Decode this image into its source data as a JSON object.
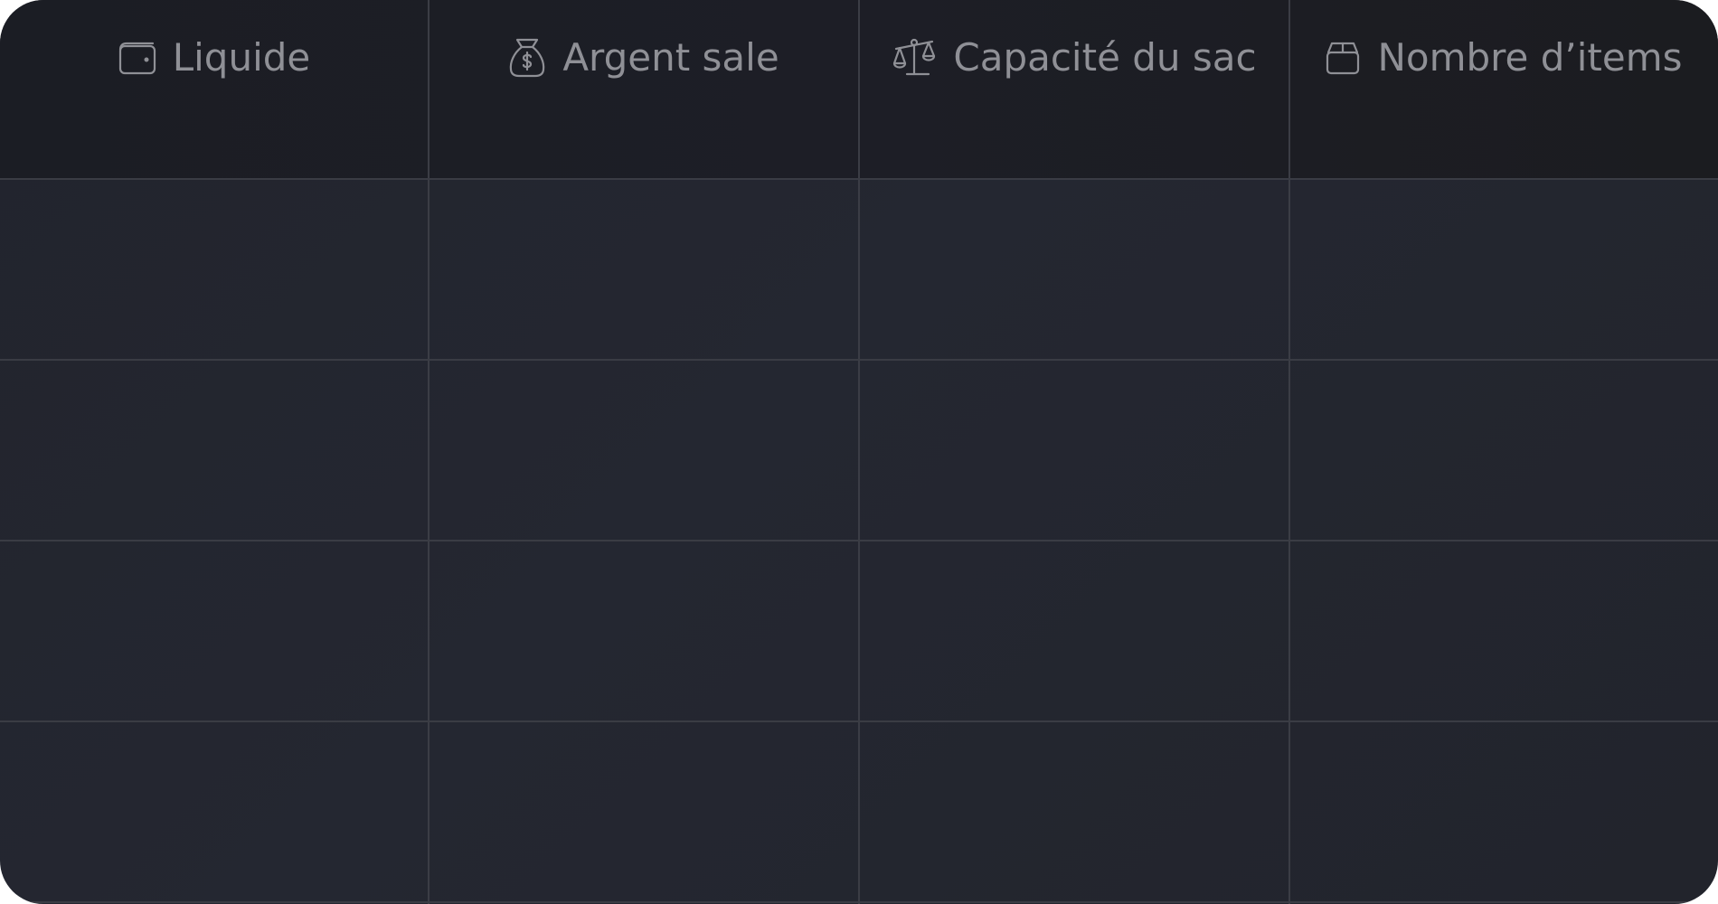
{
  "table": {
    "columns": [
      {
        "label": "Liquide",
        "icon": "wallet-icon"
      },
      {
        "label": "Argent sale",
        "icon": "money-bag-icon"
      },
      {
        "label": "Capacité du sac",
        "icon": "scale-icon"
      },
      {
        "label": "Nombre d’items",
        "icon": "box-icon"
      }
    ],
    "rows": [
      [
        "",
        "",
        "",
        ""
      ],
      [
        "",
        "",
        "",
        ""
      ],
      [
        "",
        "",
        "",
        ""
      ],
      [
        "",
        "",
        "",
        ""
      ]
    ]
  },
  "colors": {
    "header_background": "#1c1e25",
    "body_background": "#23262f",
    "grid_line": "#3b3d45",
    "header_text": "#8f9096"
  }
}
